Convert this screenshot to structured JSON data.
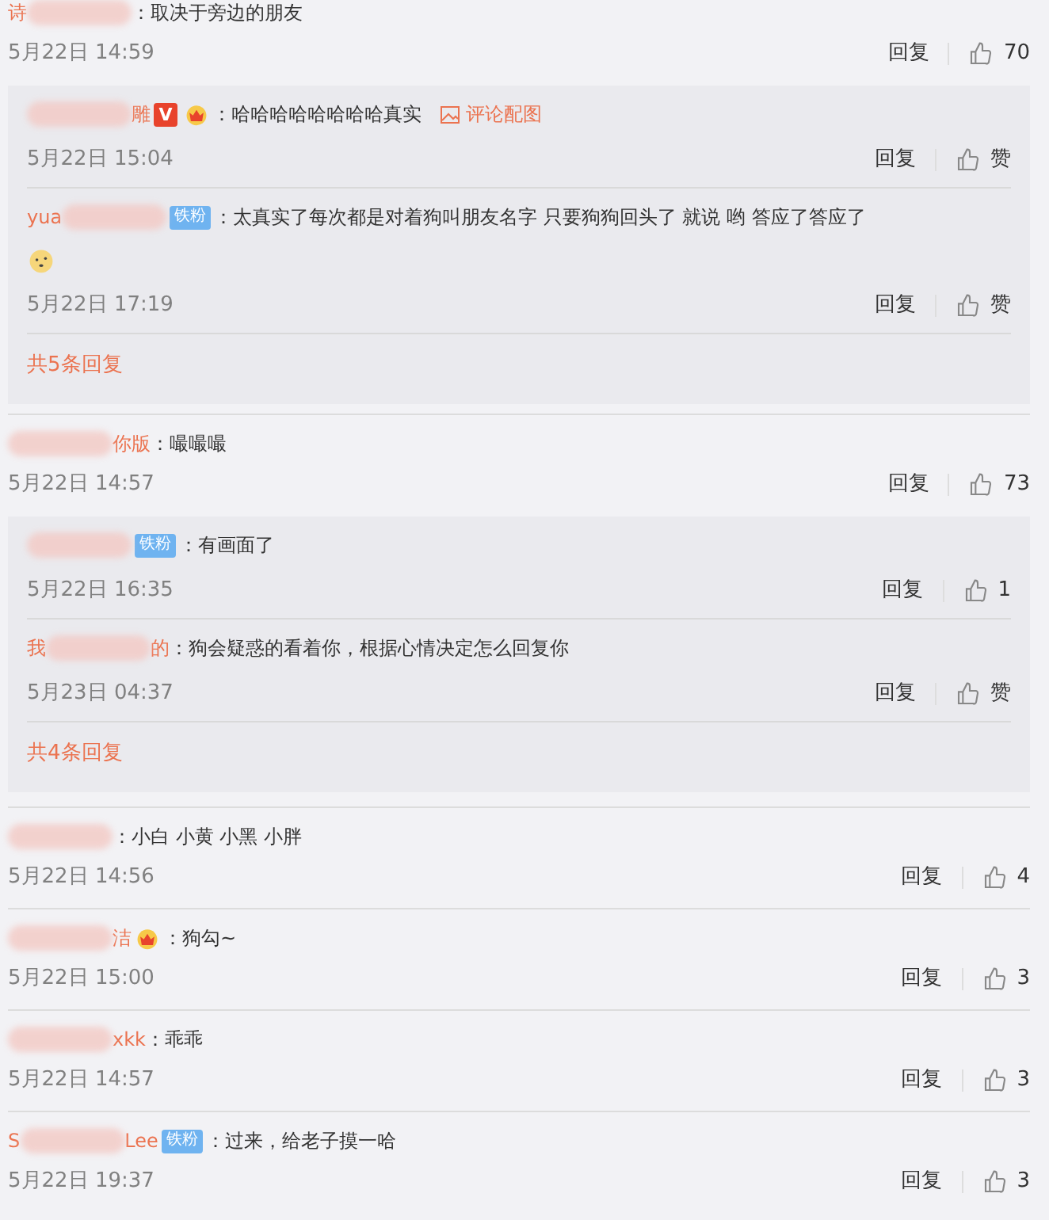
{
  "comments": [
    {
      "name_prefix": "诗",
      "text": "：取决于旁边的朋友",
      "time": "5月22日 14:59",
      "reply_label": "回复",
      "likes": "70",
      "replies": [
        {
          "name_suffix": "雕",
          "badges": [
            {
              "kind": "vip",
              "text": "V"
            },
            {
              "kind": "crown"
            }
          ],
          "text": "：哈哈哈哈哈哈哈哈真实",
          "image_link": "评论配图",
          "time": "5月22日 15:04",
          "reply_label": "回复",
          "likes": "赞"
        },
        {
          "name_prefix": "yua",
          "badges": [
            {
              "kind": "fan",
              "text": "铁粉"
            }
          ],
          "text": "：太真实了每次都是对着狗叫朋友名字 只要狗狗回头了 就说 哟 答应了答应了",
          "has_emoji": true,
          "time": "5月22日 17:19",
          "reply_label": "回复",
          "likes": "赞"
        }
      ],
      "more": "共5条回复"
    },
    {
      "name_suffix": "你版",
      "text": "：嘬嘬嘬",
      "time": "5月22日 14:57",
      "reply_label": "回复",
      "likes": "73",
      "replies": [
        {
          "badges": [
            {
              "kind": "fan",
              "text": "铁粉"
            }
          ],
          "text": "：有画面了",
          "time": "5月22日 16:35",
          "reply_label": "回复",
          "likes": "1"
        },
        {
          "name_prefix": "我",
          "name_suffix": "的",
          "text": "：狗会疑惑的看着你，根据心情决定怎么回复你",
          "time": "5月23日 04:37",
          "reply_label": "回复",
          "likes": "赞"
        }
      ],
      "more": "共4条回复"
    },
    {
      "text": "：小白 小黄 小黑 小胖",
      "time": "5月22日 14:56",
      "reply_label": "回复",
      "likes": "4"
    },
    {
      "name_suffix": "洁",
      "badges": [
        {
          "kind": "crown"
        }
      ],
      "text": "：狗勾~",
      "time": "5月22日 15:00",
      "reply_label": "回复",
      "likes": "3"
    },
    {
      "name_suffix": "xkk",
      "text": "：乖乖",
      "time": "5月22日 14:57",
      "reply_label": "回复",
      "likes": "3"
    },
    {
      "name_prefix": "S",
      "name_suffix": "Lee",
      "badges": [
        {
          "kind": "fan",
          "text": "铁粉"
        }
      ],
      "text": "：过来，给老子摸一哈",
      "time": "5月22日 19:37",
      "reply_label": "回复",
      "likes": "3"
    }
  ]
}
